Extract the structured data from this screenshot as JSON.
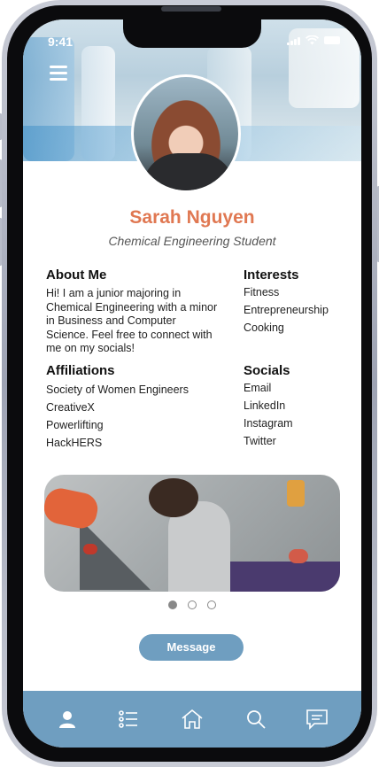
{
  "status_bar": {
    "time": "9:41"
  },
  "profile": {
    "name": "Sarah Nguyen",
    "role": "Chemical Engineering Student"
  },
  "about": {
    "heading": "About Me",
    "lines": [
      "Hi! I am a junior majoring in",
      "Chemical Engineering with a minor",
      "in Business and Computer",
      "Science. Feel free to connect with",
      "me on my socials!"
    ]
  },
  "interests": {
    "heading": "Interests",
    "items": [
      "Fitness",
      "Entrepreneurship",
      "Cooking"
    ]
  },
  "affiliations": {
    "heading": "Affiliations",
    "items": [
      "Society of Women Engineers",
      "CreativeX",
      "Powerlifting",
      "HackHERS"
    ]
  },
  "socials": {
    "heading": "Socials",
    "items": [
      "Email",
      "LinkedIn",
      "Instagram",
      "Twitter"
    ]
  },
  "carousel": {
    "current_page": 1,
    "total_pages": 3
  },
  "actions": {
    "message_label": "Message"
  },
  "nav": {
    "items": [
      "profile-icon",
      "list-icon",
      "home-icon",
      "search-icon",
      "chat-icon"
    ]
  },
  "colors": {
    "accent_name": "#e07852",
    "primary_blue": "#6f9ec0",
    "text": "#222222"
  }
}
